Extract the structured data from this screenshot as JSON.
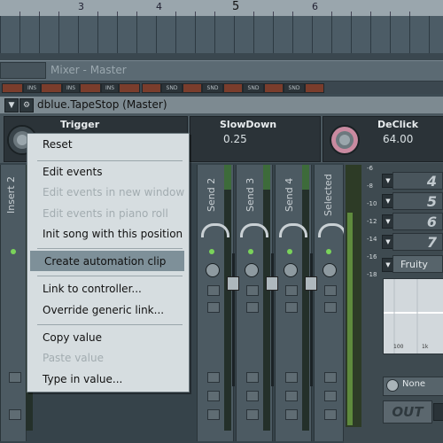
{
  "ruler": {
    "marks": [
      "3",
      "4",
      "5",
      "6"
    ]
  },
  "mixer": {
    "title": "Mixer - Master"
  },
  "slots": {
    "labels": [
      "INS",
      "INS",
      "INS",
      "SND",
      "SND",
      "SND",
      "SND"
    ]
  },
  "plugin": {
    "title": "dblue.TapeStop (Master)",
    "params": [
      {
        "label": "Trigger",
        "value": ""
      },
      {
        "label": "SlowDown",
        "value": "0.25"
      },
      {
        "label": "DeClick",
        "value": "64.00"
      }
    ]
  },
  "strips": {
    "labels": [
      "Insert 2",
      "Send 2",
      "Send 3",
      "Send 4",
      "Selected"
    ]
  },
  "right_panel": {
    "scale": [
      "-6",
      "-8",
      "-10",
      "-12",
      "-14",
      "-16",
      "-18"
    ],
    "slot_numbers": [
      "4",
      "5",
      "6",
      "7"
    ],
    "effect_name": "Fruity Lim",
    "eq_labels": [
      "100",
      "1k"
    ],
    "none_label": "None",
    "out_label": "OUT"
  },
  "context_menu": {
    "items": [
      {
        "label": "Reset",
        "enabled": true
      },
      {
        "label": "Edit events",
        "enabled": true
      },
      {
        "label": "Edit events in new window",
        "enabled": false
      },
      {
        "label": "Edit events in piano roll",
        "enabled": false
      },
      {
        "label": "Init song with this position",
        "enabled": true
      },
      {
        "label": "Create automation clip",
        "enabled": true,
        "highlighted": true
      },
      {
        "label": "Link to controller...",
        "enabled": true
      },
      {
        "label": "Override generic link...",
        "enabled": true
      },
      {
        "label": "Copy value",
        "enabled": true
      },
      {
        "label": "Paste value",
        "enabled": false
      },
      {
        "label": "Type in value...",
        "enabled": true
      }
    ]
  }
}
